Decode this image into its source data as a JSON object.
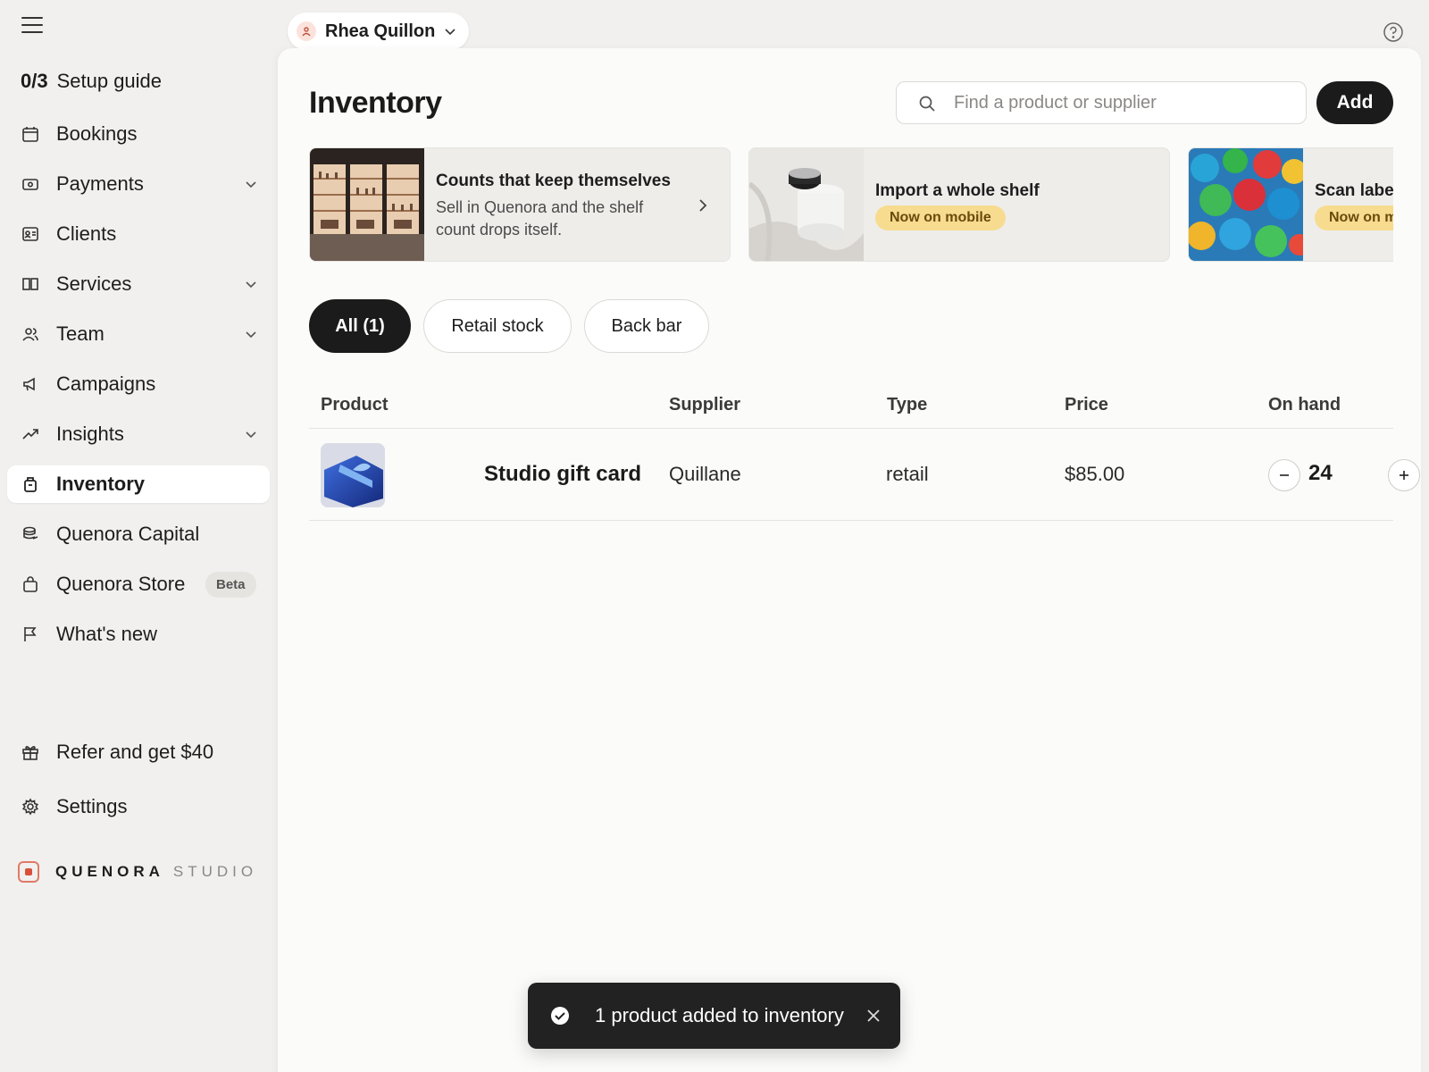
{
  "sidebar": {
    "setup": {
      "count": "0/3",
      "label": "Setup guide"
    },
    "items": [
      {
        "label": "Bookings",
        "icon": "calendar-icon"
      },
      {
        "label": "Payments",
        "icon": "payments-icon"
      },
      {
        "label": "Clients",
        "icon": "contact-card-icon"
      },
      {
        "label": "Services",
        "icon": "book-icon"
      },
      {
        "label": "Team",
        "icon": "team-icon"
      },
      {
        "label": "Campaigns",
        "icon": "megaphone-icon"
      },
      {
        "label": "Insights",
        "icon": "trend-icon"
      },
      {
        "label": "Inventory",
        "icon": "inventory-icon"
      },
      {
        "label": "Quenora Capital",
        "icon": "coins-icon"
      },
      {
        "label": "Quenora Store",
        "icon": "bag-icon",
        "badge": "Beta"
      },
      {
        "label": "What's new",
        "icon": "flag-icon"
      },
      {
        "label": "Refer and get $40",
        "icon": "gift-icon"
      },
      {
        "label": "Settings",
        "icon": "gear-icon"
      }
    ],
    "active": "Inventory",
    "brand": {
      "name": "QUENORA",
      "suffix": "STUDIO"
    }
  },
  "topbar": {
    "account_name": "Rhea Quillon"
  },
  "page": {
    "title": "Inventory",
    "search_placeholder": "Find a product or supplier",
    "add_label": "Add"
  },
  "promos": [
    {
      "title": "Counts that keep themselves",
      "desc": "Sell in Quenora and the shelf count drops itself."
    },
    {
      "title": "Import a whole shelf",
      "badge": "Now on mobile"
    },
    {
      "title": "Scan labels",
      "badge": "Now on mobile"
    }
  ],
  "filters": [
    {
      "label": "All (1)",
      "active": true
    },
    {
      "label": "Retail stock",
      "active": false
    },
    {
      "label": "Back bar",
      "active": false
    }
  ],
  "table": {
    "columns": [
      "Product",
      "Supplier",
      "Type",
      "Price",
      "On hand"
    ],
    "rows": [
      {
        "product": "Studio gift card",
        "supplier": "Quillane",
        "type": "retail",
        "price": "$85.00",
        "on_hand": "24"
      }
    ]
  },
  "toast": {
    "message": "1 product added to inventory"
  },
  "colors": {
    "accent": "#1b1b1b",
    "badge_bg": "#f7dc8f",
    "brand": "#d8503a"
  }
}
